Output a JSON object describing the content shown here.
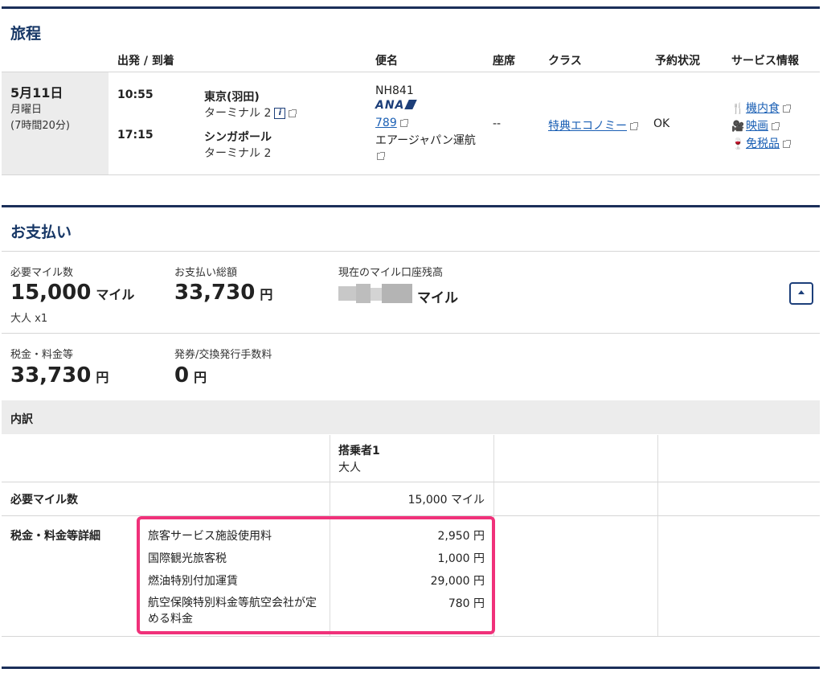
{
  "itinerary": {
    "title": "旅程",
    "headers": {
      "depart_arrive": "出発 / 到着",
      "flight": "便名",
      "seat": "座席",
      "class": "クラス",
      "status": "予約状況",
      "service": "サービス情報"
    },
    "date": "5月11日",
    "weekday": "月曜日",
    "duration": "(7時間20分)",
    "depart_time": "10:55",
    "depart_city": "東京(羽田)",
    "depart_terminal": "ターミナル 2",
    "arrive_time": "17:15",
    "arrive_city": "シンガポール",
    "arrive_terminal": "ターミナル 2",
    "flight_number": "NH841",
    "airline_logo": "ANA",
    "aircraft": "789",
    "operator": "エアージャパン運航",
    "seat": "--",
    "fare_class": "特典エコノミー",
    "status": "OK",
    "services": [
      {
        "icon": "meal-icon",
        "label": "機内食"
      },
      {
        "icon": "movie-icon",
        "label": "映画"
      },
      {
        "icon": "dutyfree-icon",
        "label": "免税品"
      }
    ]
  },
  "payment": {
    "title": "お支払い",
    "required_miles_label": "必要マイル数",
    "required_miles_value": "15,000",
    "miles_unit": "マイル",
    "passengers": "大人 x1",
    "total_label": "お支払い総額",
    "total_value": "33,730",
    "yen_unit": "円",
    "balance_label": "現在のマイル口座残高",
    "balance_unit": "マイル",
    "tax_label": "税金・料金等",
    "tax_value": "33,730",
    "fee_label": "発券/交換発行手数料",
    "fee_value": "0"
  },
  "breakdown": {
    "title": "内訳",
    "passenger_header": "搭乗者1",
    "passenger_type": "大人",
    "miles_row_label": "必要マイル数",
    "miles_row_value": "15,000 マイル",
    "tax_detail_label": "税金・料金等詳細",
    "items": [
      {
        "name": "旅客サービス施設使用料",
        "amount": "2,950 円"
      },
      {
        "name": "国際観光旅客税",
        "amount": "1,000 円"
      },
      {
        "name": "燃油特別付加運賃",
        "amount": "29,000 円"
      },
      {
        "name": "航空保険特別料金等航空会社が定める料金",
        "amount": "780 円"
      }
    ]
  },
  "colors": {
    "navy": "#1b2f5a",
    "title": "#173766",
    "link": "#1a5fb4",
    "highlight": "#f0317a",
    "gray_bg": "#ececec"
  }
}
